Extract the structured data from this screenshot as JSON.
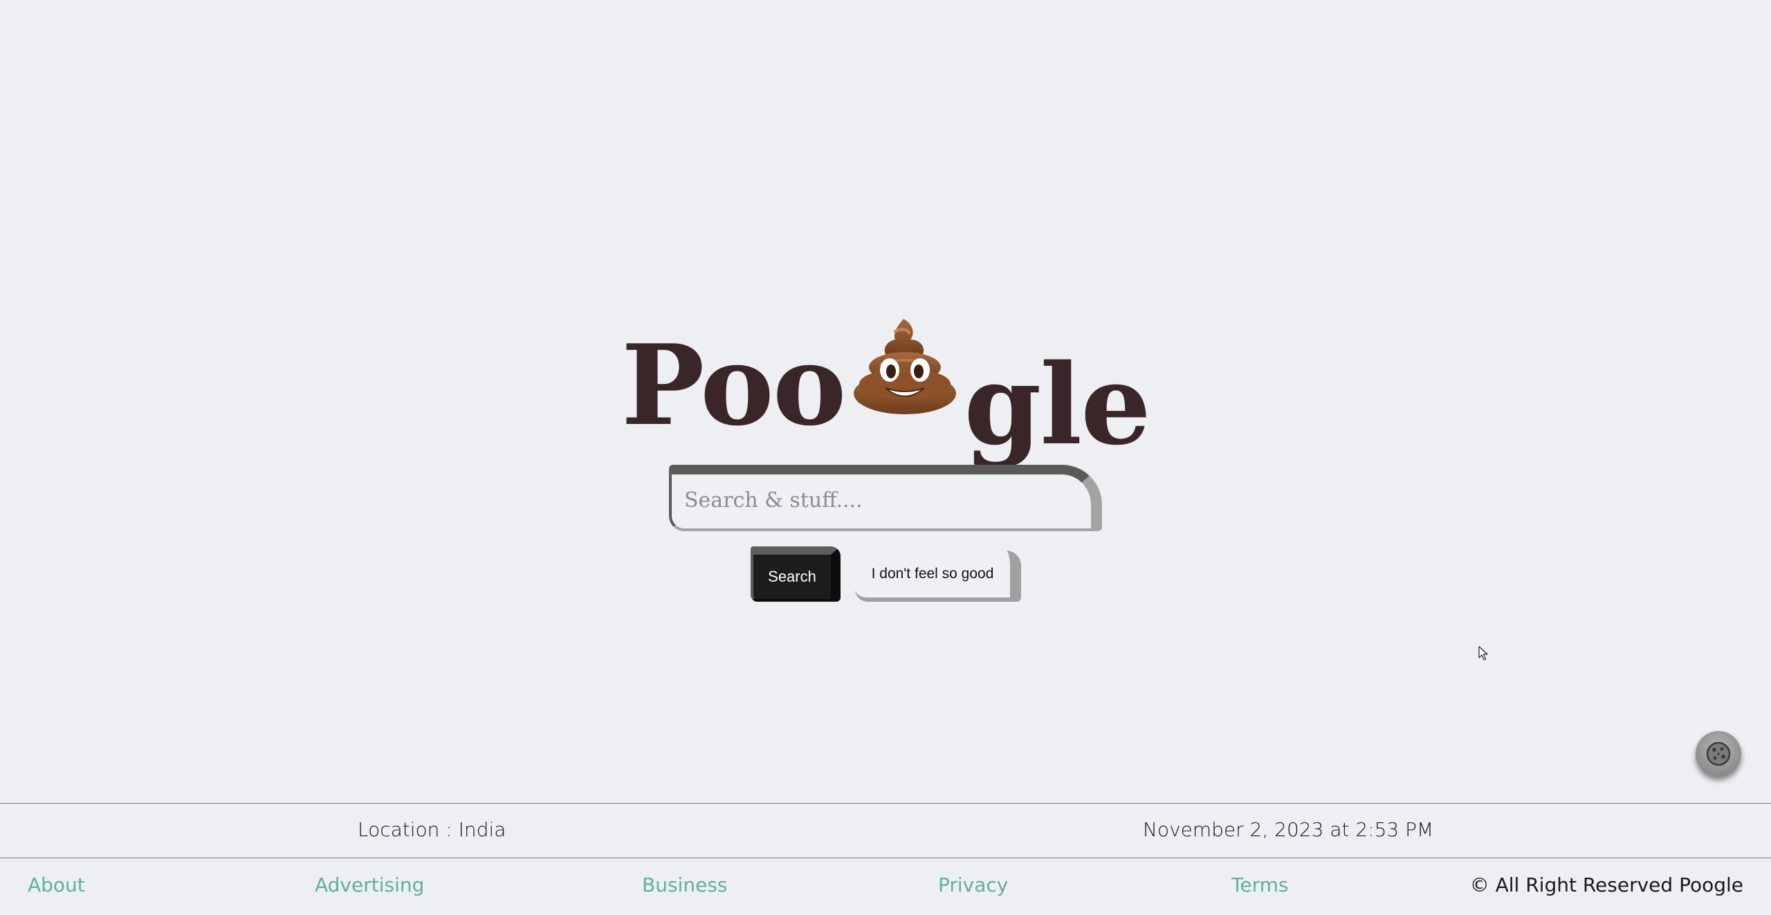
{
  "logo": {
    "text_left": "Poo",
    "icon": "poop-emoji-icon",
    "text_right": "gle"
  },
  "search": {
    "placeholder": "Search & stuff....",
    "value": ""
  },
  "buttons": {
    "search_label": "Search",
    "lucky_label": "I don't feel so good"
  },
  "cookie": {
    "icon": "cookie-icon"
  },
  "footer": {
    "location": "Location : India",
    "datetime": "November 2, 2023 at 2:53 PM",
    "links": [
      "About",
      "Advertising",
      "Business",
      "Privacy",
      "Terms"
    ],
    "copyright": "© All Right Reserved Poogle"
  },
  "colors": {
    "background": "#edeff3",
    "logo": "#3a2628",
    "link": "#5fb09c",
    "search_button": "#1d1d1d"
  }
}
